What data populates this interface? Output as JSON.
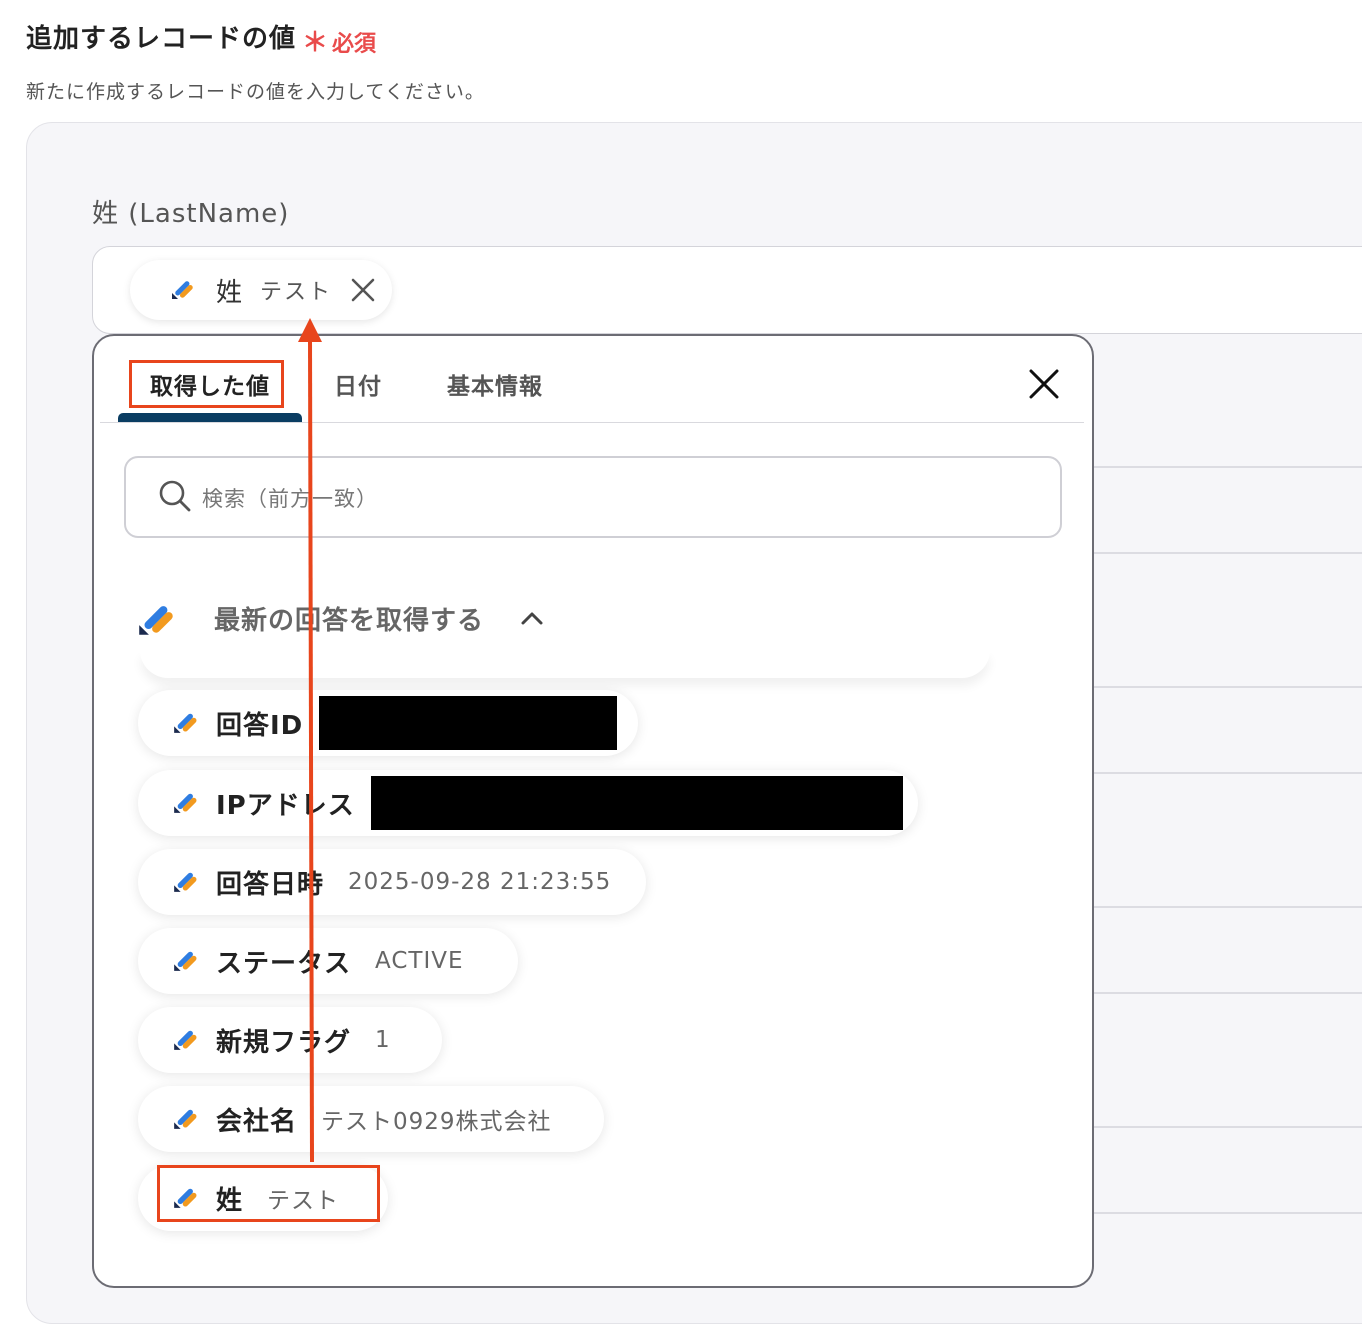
{
  "section": {
    "title": "追加するレコードの値",
    "required_star": "＊",
    "required_label": "必須",
    "description": "新たに作成するレコードの値を入力してください。"
  },
  "field": {
    "label": "姓 (LastName)",
    "chip": {
      "name": "姓",
      "value": "テスト",
      "icon": "app-logo-icon",
      "remove_icon": "close-icon"
    }
  },
  "popup": {
    "tabs": [
      {
        "label": "取得した値",
        "active": true
      },
      {
        "label": "日付",
        "active": false
      },
      {
        "label": "基本情報",
        "active": false
      }
    ],
    "close_icon": "close-icon",
    "search": {
      "placeholder": "検索（前方一致）",
      "icon": "search-icon"
    },
    "group": {
      "title": "最新の回答を取得する",
      "expanded": true,
      "icon": "chevron-up-icon"
    },
    "items": [
      {
        "name": "回答ID",
        "value": "",
        "redacted": true
      },
      {
        "name": "IPアドレス",
        "value": "",
        "redacted": true
      },
      {
        "name": "回答日時",
        "value": "2025-09-28 21:23:55"
      },
      {
        "name": "ステータス",
        "value": "ACTIVE"
      },
      {
        "name": "新規フラグ",
        "value": "1"
      },
      {
        "name": "会社名",
        "value": "テスト0929株式会社"
      },
      {
        "name": "姓",
        "value": "テスト"
      }
    ]
  },
  "colors": {
    "highlight": "#e8451c",
    "required": "#e94b4b",
    "tab_underline": "#0a3d62",
    "logo_blue": "#2f7de1",
    "logo_orange": "#f29a1f",
    "logo_navy": "#1b2a4e"
  }
}
